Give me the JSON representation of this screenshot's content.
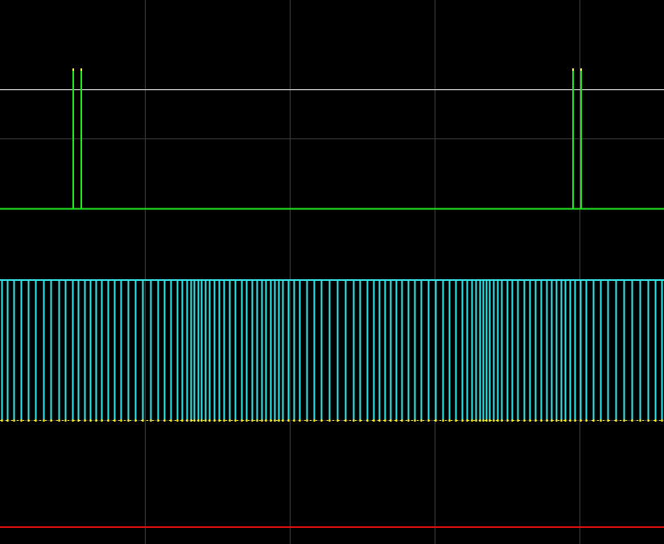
{
  "colors": {
    "background": "#000000",
    "grid": "#3c3c3c",
    "reference_level": "#ffffff",
    "trigger_trace": "#22e822",
    "trigger_tip": "#ffff33",
    "pulse_train": "#33e6ea",
    "pulse_base_marker": "#ffff33",
    "ground_trace": "#e01010"
  },
  "traces": {
    "reference": {
      "name": "reference-level-line"
    },
    "trigger": {
      "name": "trigger-trace",
      "pulse_pairs": 2
    },
    "pulse_train": {
      "name": "pulse-train-trace",
      "pulse_count": 115
    },
    "ground": {
      "name": "ground-trace"
    }
  }
}
